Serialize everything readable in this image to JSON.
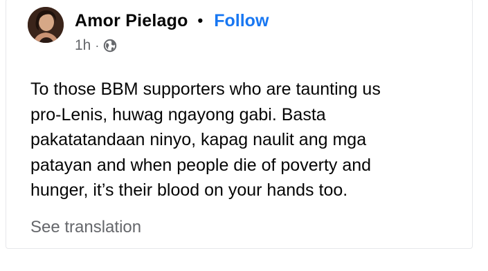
{
  "post": {
    "author": "Amor Pielago",
    "separator": "•",
    "follow_label": "Follow",
    "time": "1h",
    "time_separator": "·",
    "audience_icon": "globe-icon",
    "text_lines": [
      "To those BBM supporters who are taunting us",
      "pro-Lenis, huwag ngayong gabi. Basta",
      "pakatatandaan ninyo, kapag naulit ang mga",
      "patayan and when people die of poverty and",
      "hunger, it’s their blood on your hands too."
    ],
    "see_translation_label": "See translation"
  },
  "colors": {
    "text": "#050505",
    "secondary": "#65676b",
    "accent": "#1877f2"
  }
}
